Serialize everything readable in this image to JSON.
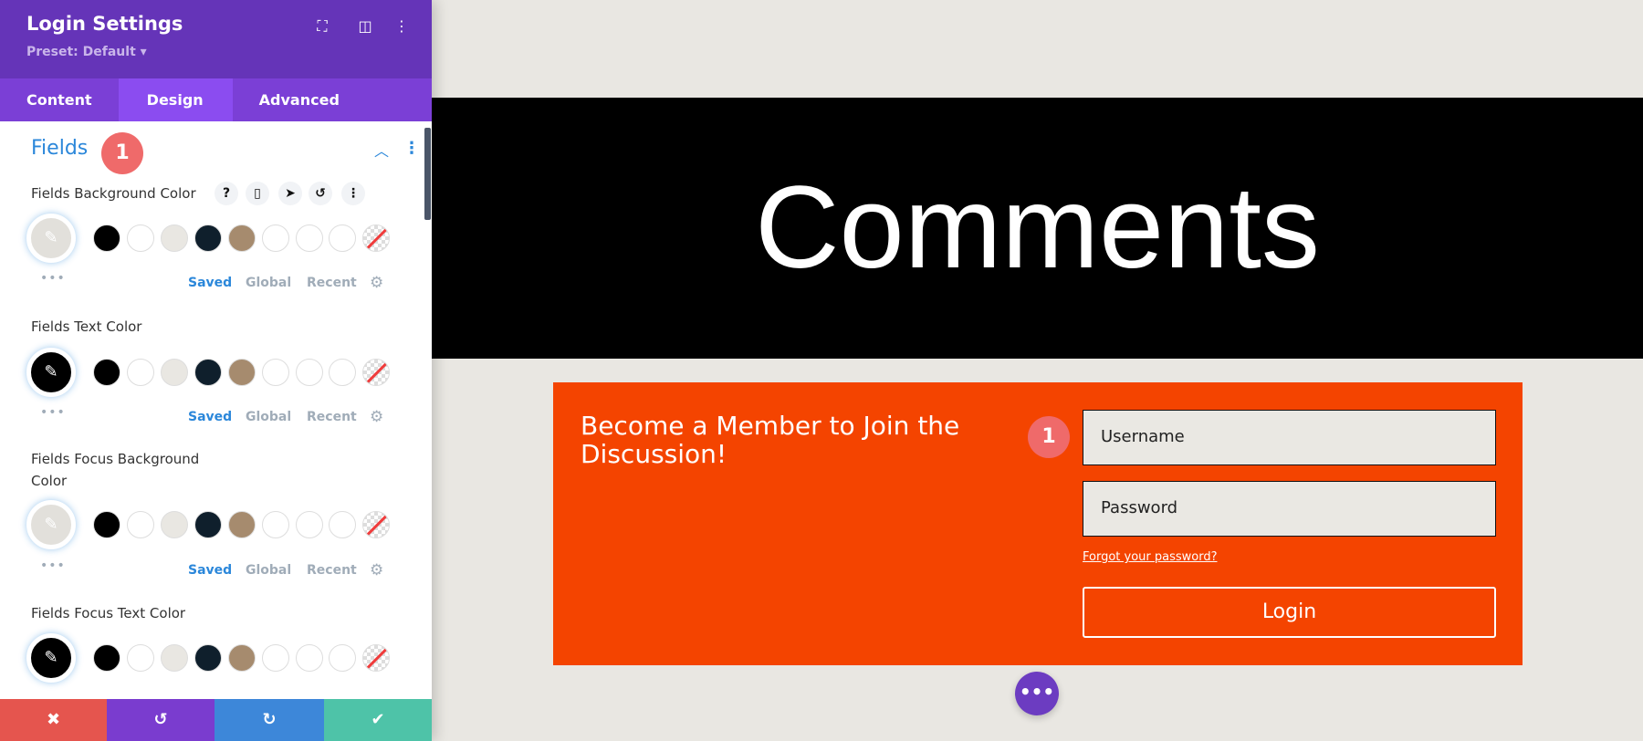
{
  "panel": {
    "title": "Login Settings",
    "preset": "Preset: Default ▾",
    "header_icons": [
      "focus-icon",
      "split-view-icon",
      "more-vertical-icon"
    ],
    "tabs": [
      {
        "label": "Content"
      },
      {
        "label": "Design"
      },
      {
        "label": "Advanced"
      }
    ],
    "active_tab": "Design",
    "section": {
      "title": "Fields",
      "badge": "1"
    },
    "palette_tabs": {
      "saved": "Saved",
      "global": "Global",
      "recent": "Recent"
    },
    "swatches": [
      "#000000",
      "#ffffff",
      "#e9e7e2",
      "#0f1f2c",
      "#a68b6e",
      "#ffffff",
      "#ffffff",
      "#ffffff",
      "none"
    ],
    "settings": [
      {
        "label": "Fields Background Color",
        "current": "#e2e0db"
      },
      {
        "label": "Fields Text Color",
        "current": "#000000"
      },
      {
        "label": "Fields Focus Background Color",
        "current": "#e2e0db"
      },
      {
        "label": "Fields Focus Text Color",
        "current": "#000000"
      }
    ],
    "colors": {
      "header": "#6534b8",
      "tabs": "#7b3fd6",
      "active_tab": "#8b4cf0",
      "cancel": "#e5554e",
      "undo": "#7a3ccf",
      "redo": "#3d87d9",
      "save": "#4ec3a8"
    }
  },
  "canvas": {
    "banner_title": "Comments",
    "login": {
      "heading": "Become a Member to Join the Discussion!",
      "badge": "1",
      "username_placeholder": "Username",
      "password_placeholder": "Password",
      "forgot": "Forgot your password?",
      "button": "Login"
    },
    "colors": {
      "background": "#e9e7e2",
      "box": "#f44400"
    }
  }
}
